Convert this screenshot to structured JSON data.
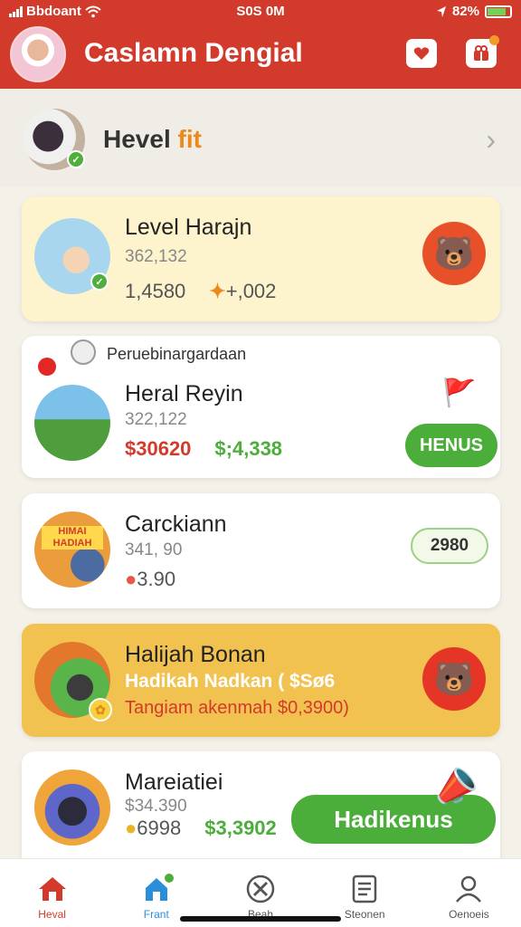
{
  "status": {
    "carrier": "Bbdoant",
    "time": "S0S 0M",
    "battery": "82%"
  },
  "header": {
    "title": "Caslamn Dengial"
  },
  "profile": {
    "name_main": "Hevel",
    "name_accent": "fit"
  },
  "cards": [
    {
      "title": "Level Harajn",
      "sub": "362,132",
      "value1": "1,4580",
      "value2": "+,002"
    },
    {
      "label": "Peruebinargardaan",
      "title": "Heral Reyin",
      "sub": "322,122",
      "value1": "$30620",
      "value2": "$;4,338",
      "button": "HENUS"
    },
    {
      "title": "Carckiann",
      "sub": "341, 90",
      "value1": "3.90",
      "button": "2980",
      "thumb_text": "HIMAI HADIAH"
    },
    {
      "title": "Halijah Bonan",
      "sub": "Hadikah Nadkan ( $Sø6",
      "value1": "Tangiam akenmah $0,3900)"
    },
    {
      "title": "Mareiatiei",
      "sub": "$34.390",
      "value1": "6998",
      "value2": "$3,3902",
      "button": "Hadikenus"
    }
  ],
  "tabs": [
    {
      "label": "Heval"
    },
    {
      "label": "Frant"
    },
    {
      "label": "Beah"
    },
    {
      "label": "Steonen"
    },
    {
      "label": "Oenoeis"
    }
  ],
  "colors": {
    "brand": "#d23a2c",
    "accent": "#e98a1a",
    "green": "#4cae3a",
    "highlight": "#f2c251"
  }
}
